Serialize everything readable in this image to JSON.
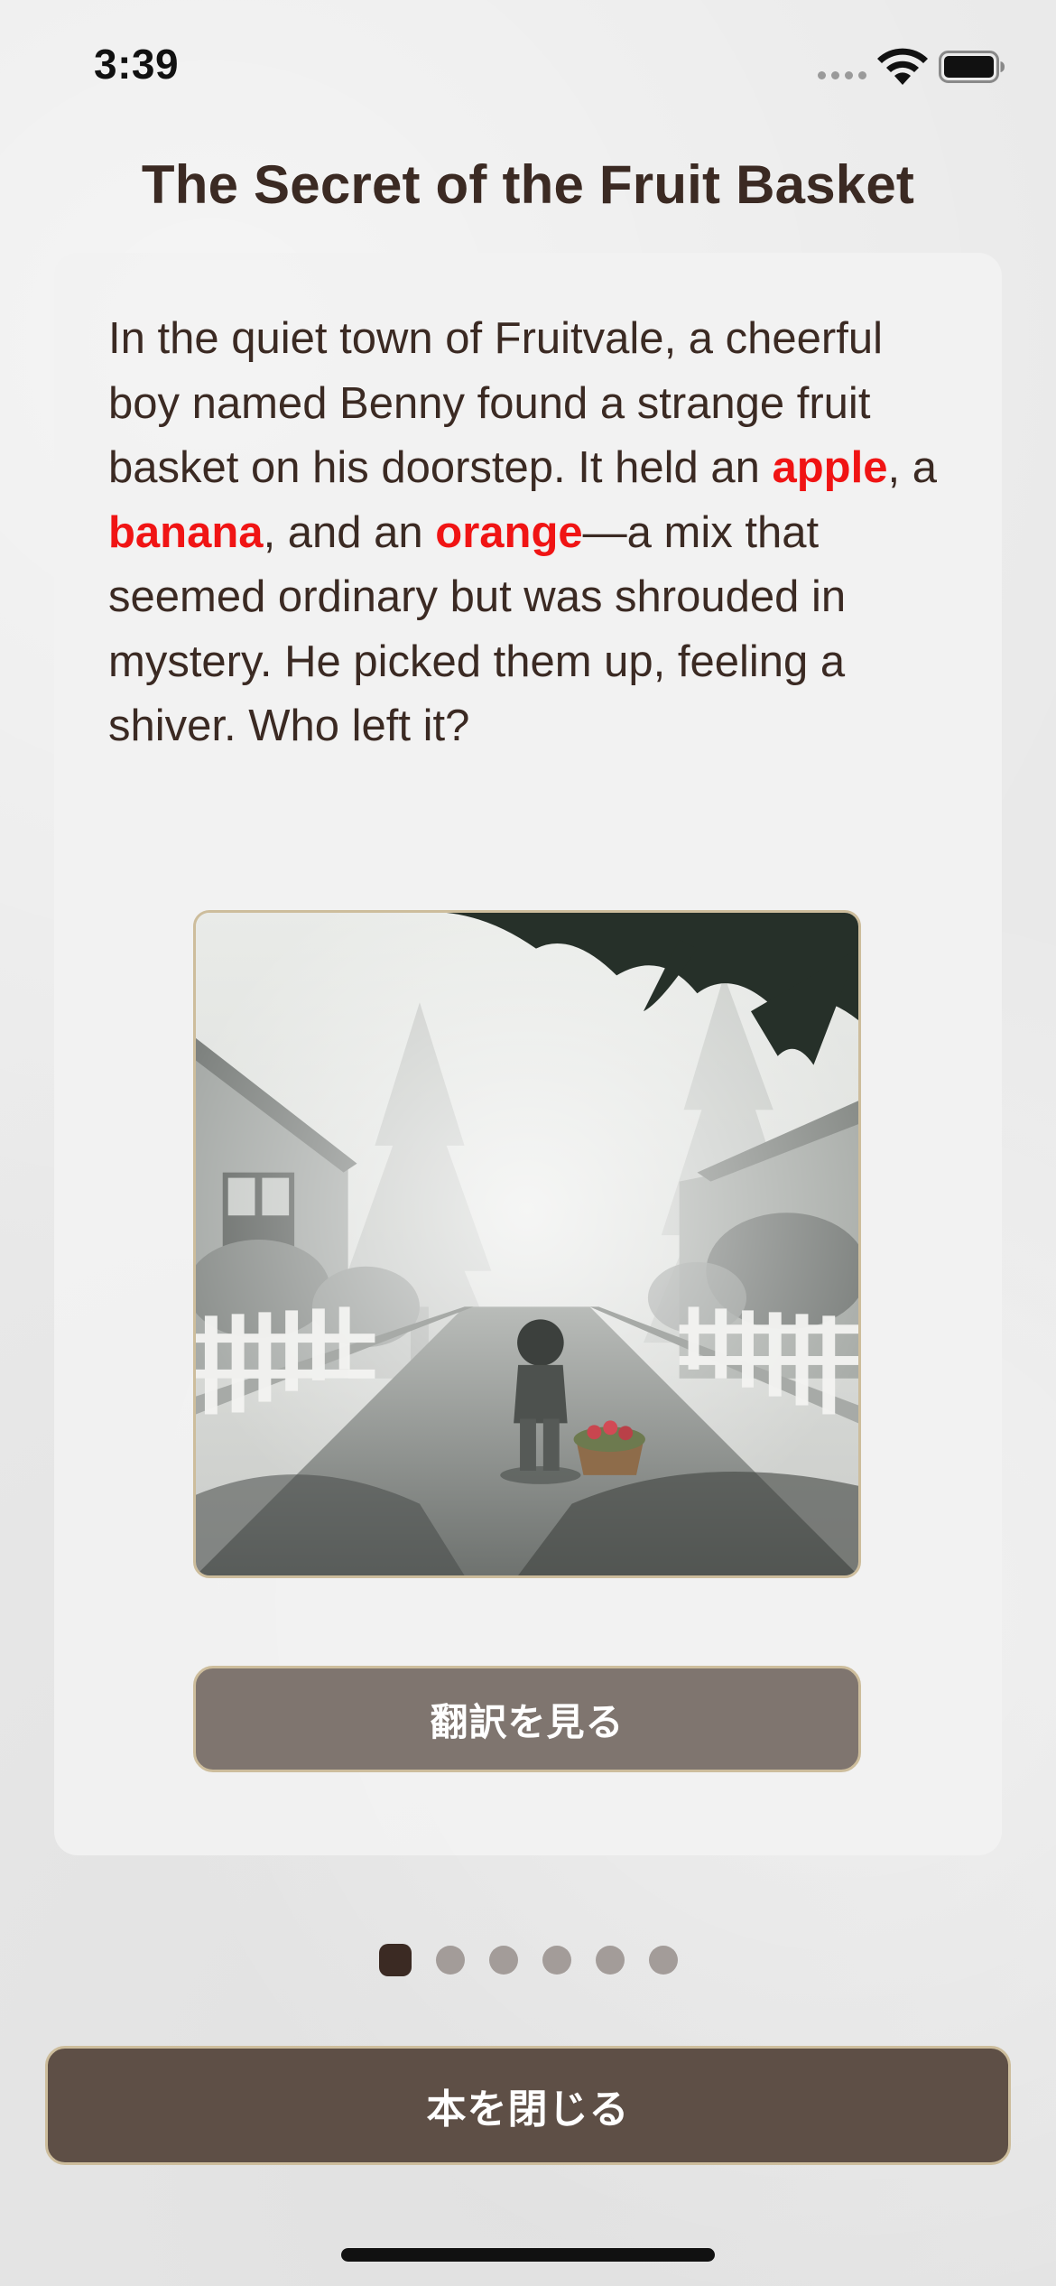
{
  "status_bar": {
    "time": "3:39"
  },
  "story": {
    "title": "The Secret of the Fruit Basket",
    "paragraph": [
      {
        "text": "In the quiet town of Fruitvale, a cheerful boy named Benny found a strange fruit basket on his doorstep. It held an ",
        "highlight": false
      },
      {
        "text": "apple",
        "highlight": true
      },
      {
        "text": ", a ",
        "highlight": false
      },
      {
        "text": "banana",
        "highlight": true
      },
      {
        "text": ", and an ",
        "highlight": false
      },
      {
        "text": "orange",
        "highlight": true
      },
      {
        "text": "—a mix that seemed ordinary but was shrouded in mystery. He picked them up, feeling a shiver. Who left it?",
        "highlight": false
      }
    ],
    "highlight_color": "#f01414"
  },
  "buttons": {
    "translate_label": "翻訳を見る",
    "close_book_label": "本を閉じる"
  },
  "pagination": {
    "total_pages": 6,
    "current_page": 1
  },
  "colors": {
    "title_text": "#3b2a23",
    "translate_button": "#7f756f",
    "close_button": "#5e4f46",
    "button_border": "#cdbd9c",
    "dot_inactive": "#a39c99",
    "dot_active": "#3b2a23"
  },
  "icons": {
    "wifi": "wifi-icon",
    "battery": "battery-icon",
    "cellular": "cellular-signal-icon"
  }
}
